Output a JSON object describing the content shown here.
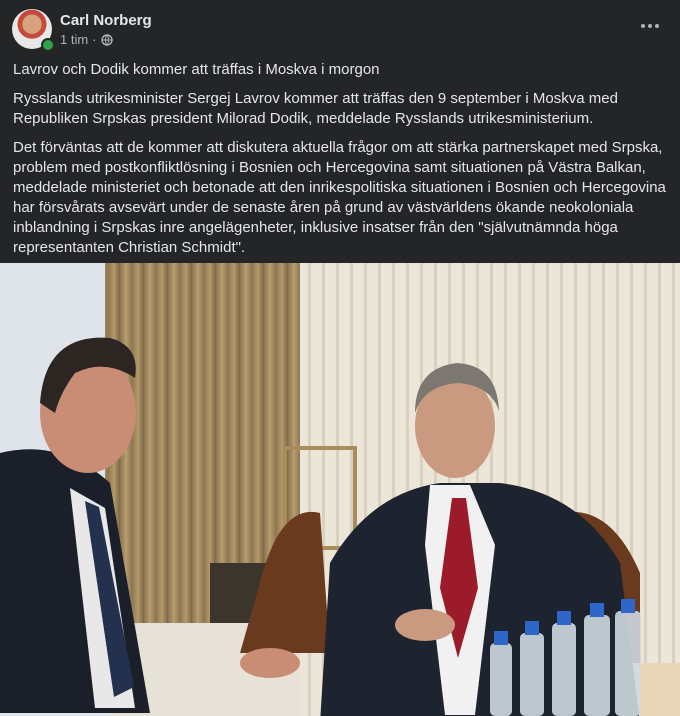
{
  "post": {
    "author": "Carl Norberg",
    "time": "1 tim",
    "separator": "·",
    "paragraphs": [
      "Lavrov och Dodik kommer att träffas i Moskva i morgon",
      "Rysslands utrikesminister Sergej Lavrov kommer att träffas den 9 september i Moskva med Republiken Srpskas president Milorad Dodik, meddelade Rysslands utrikesministerium.",
      "Det förväntas att de kommer att diskutera aktuella frågor om att stärka partnerskapet med Srpska, problem med postkonfliktlösning i Bosnien och Hercegovina samt situationen på Västra Balkan, meddelade ministeriet och betonade att den inrikespolitiska situationen i Bosnien och Hercegovina har försvårats avsevärt under de senaste åren på grund av västvärldens ökande neokoloniala inblandning i Srpskas inre angelägenheter, inklusive insatser från den \"självutnämnda höga representanten Christian Schmidt\"."
    ]
  },
  "icons": {
    "privacy": "globe-icon",
    "menu": "more-horizontal-icon"
  },
  "colors": {
    "background": "#242526",
    "text": "#e4e6eb",
    "secondary_text": "#b0b3b8",
    "online": "#31a24c"
  }
}
